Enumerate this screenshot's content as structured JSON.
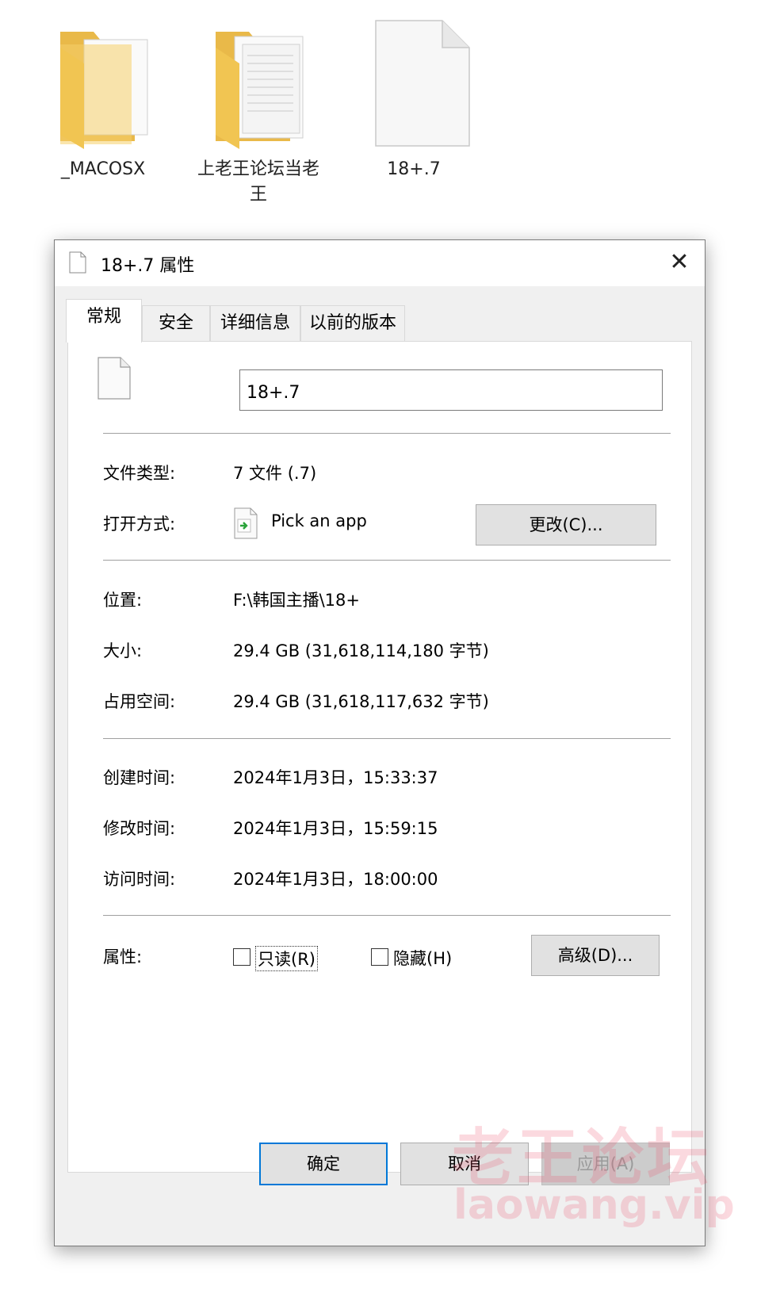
{
  "desktop": {
    "items": [
      {
        "label": "_MACOSX",
        "icon": "folder-icon"
      },
      {
        "label": "上老王论坛当老王",
        "icon": "folder-icon"
      },
      {
        "label": "18+.7",
        "icon": "file-icon"
      }
    ]
  },
  "dialog": {
    "title": "18+.7 属性",
    "tabs": [
      "常规",
      "安全",
      "详细信息",
      "以前的版本"
    ],
    "active_tab": "常规",
    "file_name": "18+.7",
    "file_type_label": "文件类型:",
    "file_type_value": "7 文件 (.7)",
    "open_with_label": "打开方式:",
    "open_with_value": "Pick an app",
    "change_button": "更改(C)...",
    "location_label": "位置:",
    "location_value": "F:\\韩国主播\\18+",
    "size_label": "大小:",
    "size_value": "29.4 GB (31,618,114,180 字节)",
    "size_on_disk_label": "占用空间:",
    "size_on_disk_value": "29.4 GB (31,618,117,632 字节)",
    "created_label": "创建时间:",
    "created_value": "2024年1月3日，15:33:37",
    "modified_label": "修改时间:",
    "modified_value": "2024年1月3日，15:59:15",
    "accessed_label": "访问时间:",
    "accessed_value": "2024年1月3日，18:00:00",
    "attributes_label": "属性:",
    "readonly_label": "只读(R)",
    "hidden_label": "隐藏(H)",
    "advanced_button": "高级(D)...",
    "ok_button": "确定",
    "cancel_button": "取消",
    "apply_button": "应用(A)"
  },
  "watermark": {
    "line1": "老王论坛",
    "line2": "laowang.vip"
  },
  "colors": {
    "folder": "#f5cf6a",
    "accent": "#0078d7",
    "open_arrow": "#2aa33a"
  }
}
